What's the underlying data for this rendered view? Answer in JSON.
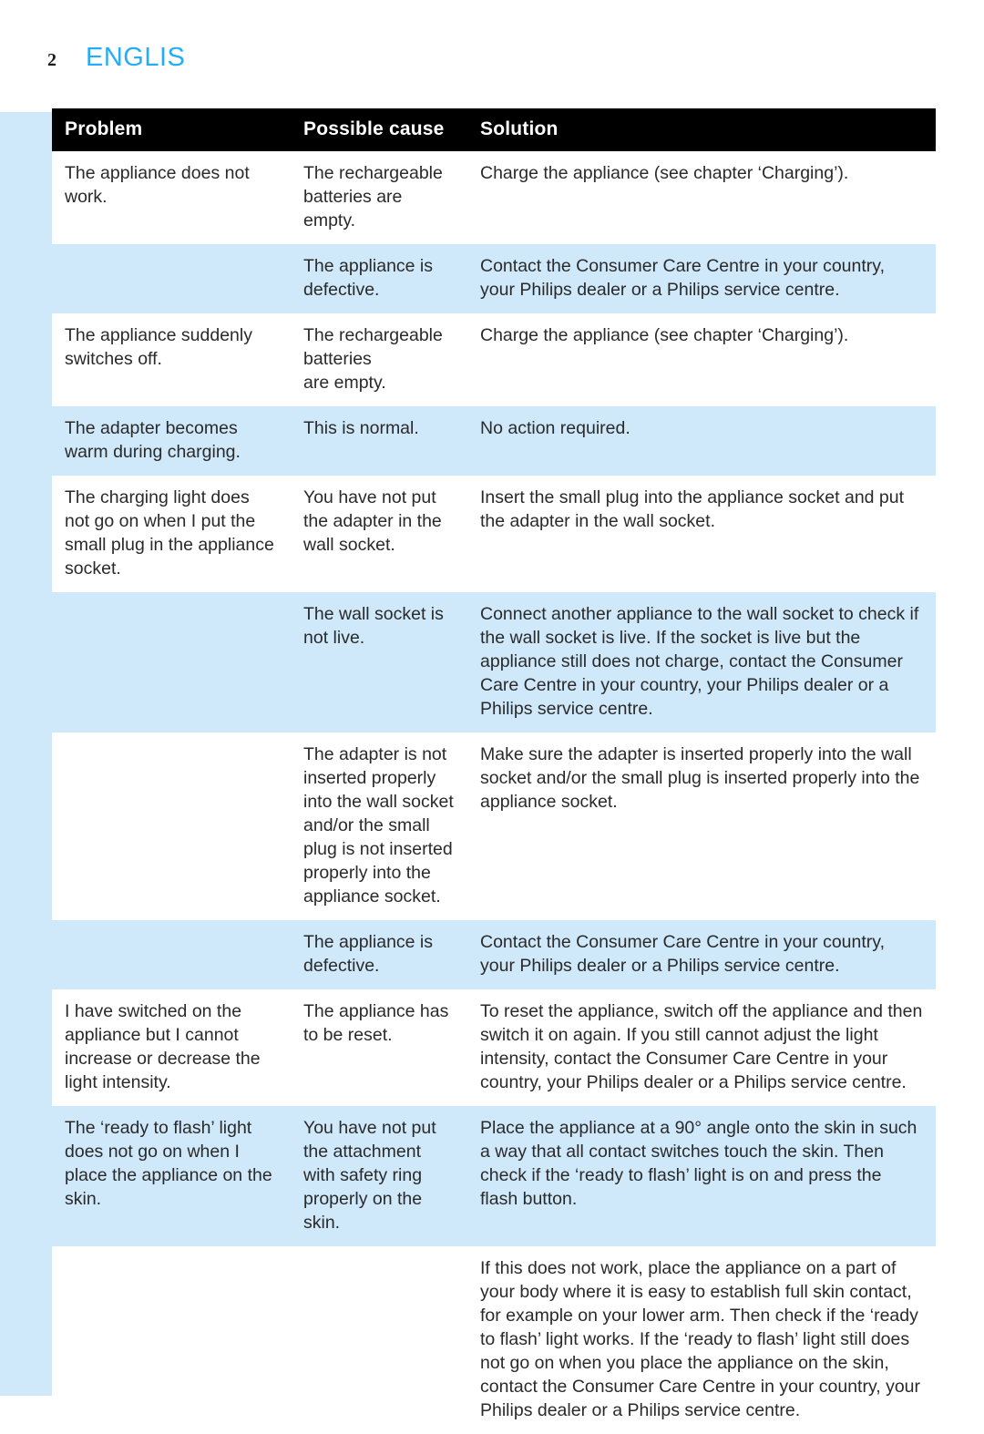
{
  "page": {
    "number": "2",
    "language": "ENGLIS",
    "accent_color": "#25aef7",
    "row_highlight_color": "#cfe9fb",
    "header_background": "#000000"
  },
  "table": {
    "columns": [
      {
        "key": "problem",
        "label": "Problem"
      },
      {
        "key": "cause",
        "label": "Possible cause"
      },
      {
        "key": "solution",
        "label": "Solution"
      }
    ],
    "rows": [
      {
        "shade": "white",
        "problem": "The appliance does not work.",
        "cause": "The rechargeable batteries are empty.",
        "solution": "Charge the appliance (see chapter ‘Charging’)."
      },
      {
        "shade": "blue",
        "problem": "",
        "cause": "The appliance is defective.",
        "solution": "Contact the Consumer Care Centre in your country, your Philips dealer or a Philips service centre."
      },
      {
        "shade": "white",
        "problem": "The appliance suddenly switches off.",
        "cause": "The rechargeable batteries\nare empty.",
        "solution": "Charge the appliance (see chapter ‘Charging’)."
      },
      {
        "shade": "blue",
        "problem": "The adapter becomes warm during charging.",
        "cause": "This is normal.",
        "solution": "No action required."
      },
      {
        "shade": "white",
        "problem": "The charging light does not go on when I put the small plug in the appliance socket.",
        "cause": "You have not put the adapter in the wall socket.",
        "solution": "Insert the small plug into the appliance socket and put the adapter in the wall socket."
      },
      {
        "shade": "blue",
        "problem": "",
        "cause": "The wall socket is not live.",
        "solution": "Connect another appliance to the wall socket to check if the wall socket is live. If the socket is live but the appliance still does not charge, contact the Consumer Care Centre in your country, your Philips dealer or a Philips service centre."
      },
      {
        "shade": "white",
        "problem": "",
        "cause": "The adapter is not inserted properly into the wall socket and/or the small plug is not inserted properly into the appliance socket.",
        "solution": "Make sure the adapter is inserted properly into the wall socket and/or the small plug is inserted properly into the appliance socket."
      },
      {
        "shade": "blue",
        "problem": "",
        "cause": "The appliance is defective.",
        "solution": "Contact the Consumer Care Centre in your country, your Philips dealer or a Philips service centre."
      },
      {
        "shade": "white",
        "problem": "I have switched on the appliance but I cannot increase or decrease the light intensity.",
        "cause": "The appliance has to be reset.",
        "solution": "To reset the appliance, switch off the appliance and then switch it on again. If you still cannot adjust the light intensity, contact the Consumer Care Centre in your country, your Philips dealer or a Philips service centre."
      },
      {
        "shade": "blue",
        "problem": "The ‘ready to flash’ light does not go on when I place the appliance on the skin.",
        "cause": "You have not put the attachment with safety ring properly on the skin.",
        "solution": "Place the appliance at a 90° angle onto the skin in such a way that all contact switches touch the skin. Then check if the ‘ready to flash’ light is on and press the flash button."
      },
      {
        "shade": "white",
        "problem": "",
        "cause": "",
        "solution": "If this does not work, place the appliance on a part of your body where it is easy to establish full skin contact, for example on your lower arm. Then check if the ‘ready to flash’ light works. If the ‘ready to flash’ light still does not go on when you place the appliance on the skin, contact the Consumer Care Centre in your country, your Philips dealer or a Philips service centre."
      }
    ]
  }
}
